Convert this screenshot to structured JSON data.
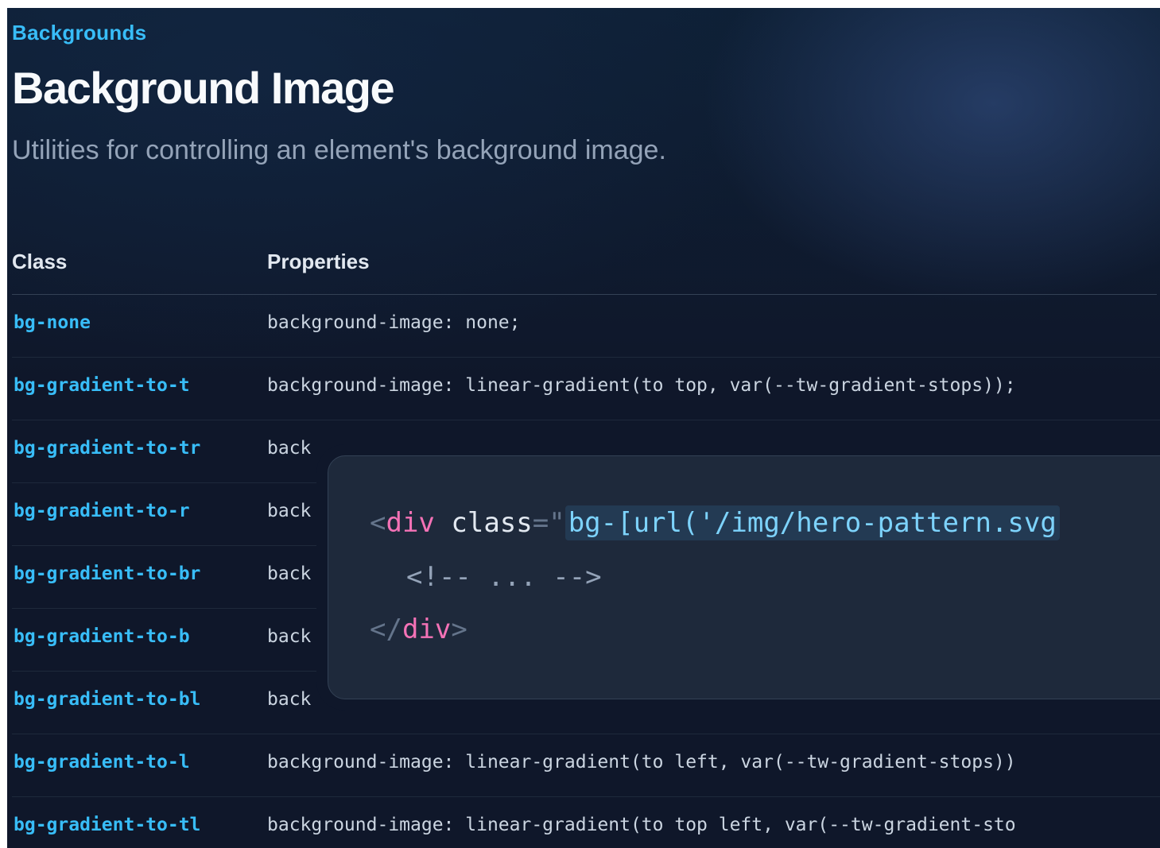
{
  "header": {
    "eyebrow": "Backgrounds",
    "title": "Background Image",
    "lead": "Utilities for controlling an element's background image."
  },
  "table": {
    "columns": [
      "Class",
      "Properties"
    ],
    "rows": [
      {
        "class": "bg-none",
        "properties": "background-image: none;"
      },
      {
        "class": "bg-gradient-to-t",
        "properties": "background-image: linear-gradient(to top, var(--tw-gradient-stops));"
      },
      {
        "class": "bg-gradient-to-tr",
        "properties": "back"
      },
      {
        "class": "bg-gradient-to-r",
        "properties": "back"
      },
      {
        "class": "bg-gradient-to-br",
        "properties": "back"
      },
      {
        "class": "bg-gradient-to-b",
        "properties": "back"
      },
      {
        "class": "bg-gradient-to-bl",
        "properties": "back"
      },
      {
        "class": "bg-gradient-to-l",
        "properties": "background-image: linear-gradient(to left, var(--tw-gradient-stops))"
      },
      {
        "class": "bg-gradient-to-tl",
        "properties": "background-image: linear-gradient(to top left, var(--tw-gradient-sto"
      }
    ]
  },
  "code_example": {
    "line1": {
      "open": "<",
      "tag": "div",
      "attr": " class",
      "eq": "=",
      "quote": "\"",
      "value": "bg-[url('/img/hero-pattern.svg"
    },
    "line2": "<!-- ... -->",
    "line3": {
      "open": "</",
      "tag": "div",
      "close": ">"
    }
  },
  "colors": {
    "background": "#0f172a",
    "accent": "#38bdf8",
    "tag": "#f472b6",
    "panel": "#1e293b"
  }
}
